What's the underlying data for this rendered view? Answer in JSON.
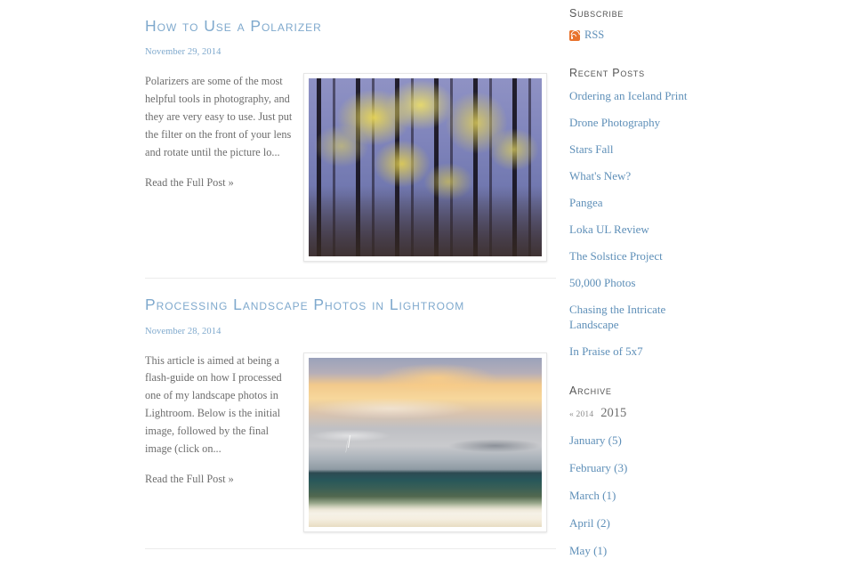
{
  "posts": [
    {
      "title": "How to Use a Polarizer",
      "date": "November 29, 2014",
      "excerpt": "Polarizers are some of the most helpful tools in photography, and they are very easy to use. Just put the filter on the front of your lens and rotate until the picture lo...",
      "read_more": "Read the Full Post »",
      "image_name": "autumn-forest-yellow-leaves-photo"
    },
    {
      "title": "Processing Landscape Photos in Lightroom",
      "date": "November 28, 2014",
      "excerpt": "This article is aimed at being a flash-guide on how I processed one of my landscape photos in Lightroom. Below is the initial image, followed by the final image (click on...",
      "read_more": "Read the Full Post »",
      "image_name": "sunset-seascape-lightning-photo"
    }
  ],
  "sidebar": {
    "subscribe": {
      "heading": "Subscribe",
      "rss_label": "RSS",
      "rss_icon": "rss-icon",
      "rss_color": "#e8722c"
    },
    "recent_posts": {
      "heading": "Recent Posts",
      "items": [
        "Ordering an Iceland Print",
        "Drone Photography",
        "Stars Fall",
        "What's New?",
        "Pangea",
        "Loka UL Review",
        "The Solstice Project",
        "50,000 Photos",
        "Chasing the Intricate Landscape",
        "In Praise of 5x7"
      ]
    },
    "archive": {
      "heading": "Archive",
      "prev_year": "« 2014",
      "current_year": "2015",
      "months": [
        "January (5)",
        "February (3)",
        "March (1)",
        "April (2)",
        "May (1)"
      ]
    }
  },
  "colors": {
    "link_blue": "#5e8fb8",
    "title_blue": "#7fa9cd",
    "body_gray": "#6d6d6d",
    "heading_gray": "#555555",
    "divider": "#ececec",
    "rss_orange": "#e8722c"
  }
}
